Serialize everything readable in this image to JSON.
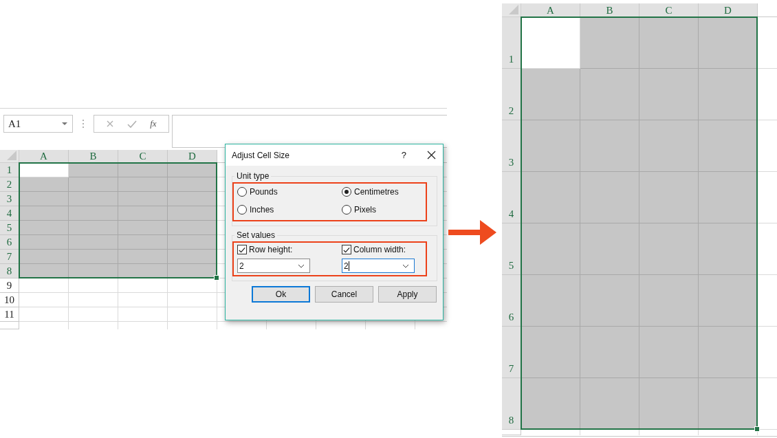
{
  "left_sheet": {
    "name_box": "A1",
    "formula_bar": {
      "function_label": "fx"
    },
    "columns": [
      {
        "label": "A",
        "selected": true
      },
      {
        "label": "B",
        "selected": true
      },
      {
        "label": "C",
        "selected": true
      },
      {
        "label": "D",
        "selected": true
      }
    ],
    "rows": [
      {
        "label": "1",
        "selected": true
      },
      {
        "label": "2",
        "selected": true
      },
      {
        "label": "3",
        "selected": true
      },
      {
        "label": "4",
        "selected": true
      },
      {
        "label": "5",
        "selected": true
      },
      {
        "label": "6",
        "selected": true
      },
      {
        "label": "7",
        "selected": true
      },
      {
        "label": "8",
        "selected": true
      },
      {
        "label": "9",
        "selected": false
      },
      {
        "label": "10",
        "selected": false
      },
      {
        "label": "11",
        "selected": false
      }
    ]
  },
  "dialog": {
    "title": "Adjust Cell Size",
    "help": "?",
    "unit_type": {
      "label": "Unit type",
      "options": [
        {
          "label": "Pounds",
          "selected": false
        },
        {
          "label": "Centimetres",
          "selected": true
        },
        {
          "label": "Inches",
          "selected": false
        },
        {
          "label": "Pixels",
          "selected": false
        }
      ]
    },
    "set_values": {
      "label": "Set values",
      "fields": [
        {
          "label": "Row height:",
          "checked": true,
          "value": "2",
          "focused": false
        },
        {
          "label": "Column width:",
          "checked": true,
          "value": "2",
          "focused": true
        }
      ]
    },
    "buttons": [
      {
        "label": "Ok",
        "default": true
      },
      {
        "label": "Cancel",
        "default": false
      },
      {
        "label": "Apply",
        "default": false
      }
    ]
  },
  "right_sheet": {
    "columns": [
      {
        "label": "A",
        "selected": true
      },
      {
        "label": "B",
        "selected": true
      },
      {
        "label": "C",
        "selected": true
      },
      {
        "label": "D",
        "selected": true
      }
    ],
    "rows": [
      {
        "label": "1",
        "selected": true
      },
      {
        "label": "2",
        "selected": true
      },
      {
        "label": "3",
        "selected": true
      },
      {
        "label": "4",
        "selected": true
      },
      {
        "label": "5",
        "selected": true
      },
      {
        "label": "6",
        "selected": true
      },
      {
        "label": "7",
        "selected": true
      },
      {
        "label": "8",
        "selected": true
      }
    ]
  }
}
